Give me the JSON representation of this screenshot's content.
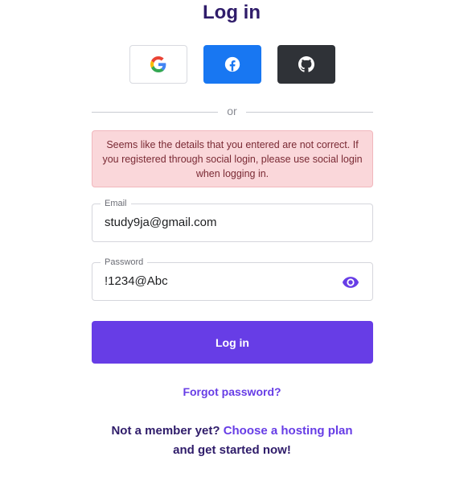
{
  "page": {
    "title": "Log in"
  },
  "social": {
    "google": {
      "icon": "google-icon"
    },
    "facebook": {
      "icon": "facebook-icon"
    },
    "github": {
      "icon": "github-icon"
    }
  },
  "divider": {
    "text": "or"
  },
  "alert": {
    "message": "Seems like the details that you entered are not correct. If you registered through social login, please use social login when logging in."
  },
  "form": {
    "email": {
      "label": "Email",
      "value": "study9ja@gmail.com"
    },
    "password": {
      "label": "Password",
      "value": "!1234@Abc",
      "toggle_icon": "eye-icon"
    },
    "submit_label": "Log in"
  },
  "links": {
    "forgot": "Forgot password?"
  },
  "footer": {
    "prefix": "Not a member yet?",
    "link": "Choose a hosting plan",
    "suffix": "and get started now!"
  },
  "colors": {
    "primary": "#673de6",
    "heading": "#2f1c6a",
    "facebook": "#1877f2",
    "github": "#2f3237",
    "alert_bg": "#fad7da"
  }
}
